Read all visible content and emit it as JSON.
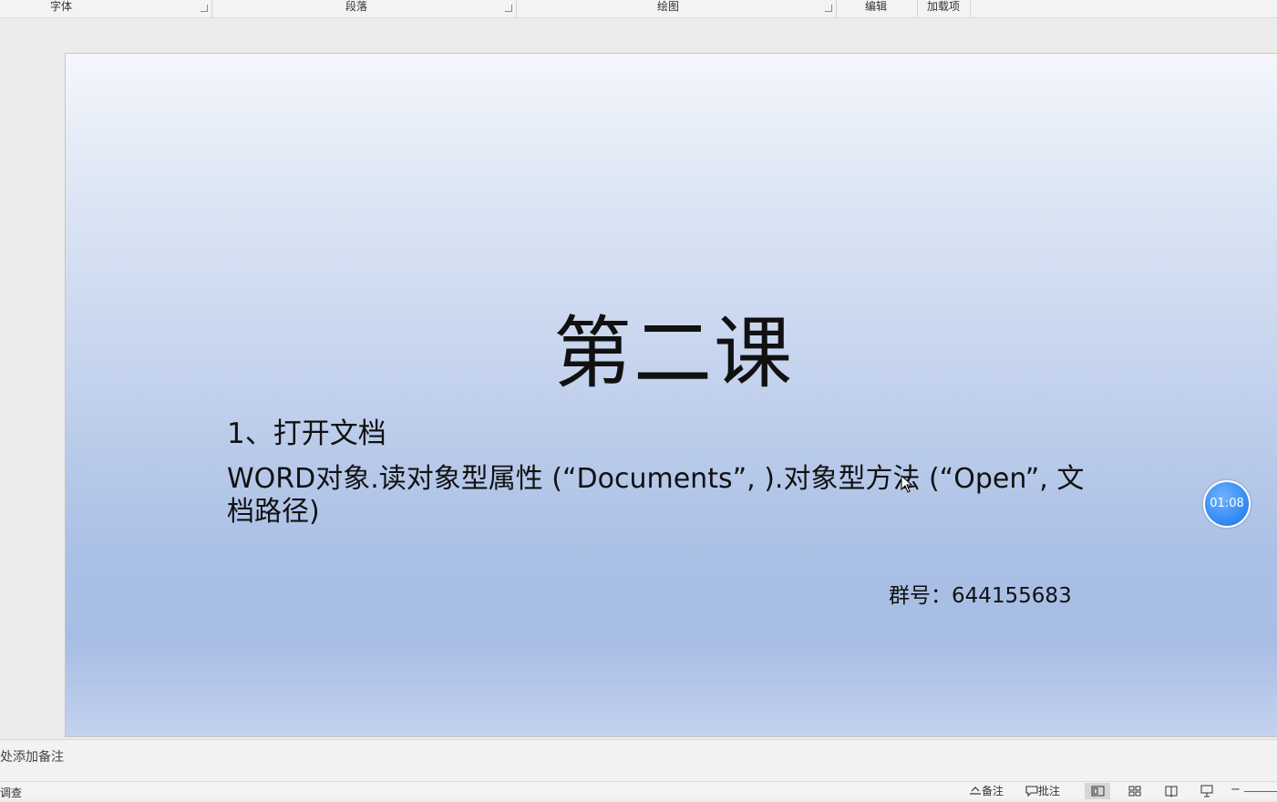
{
  "ribbon": {
    "groups": [
      "字体",
      "段落",
      "绘图",
      "编辑",
      "加载项"
    ]
  },
  "slide": {
    "title": "第二课",
    "bullet1": "1、打开文档",
    "body": "WORD对象.读对象型属性 (“Documents”, ).对象型方法 (“Open”, 文档路径)",
    "group_number": "群号：644155683"
  },
  "timer": {
    "value": "01:08"
  },
  "notes": {
    "placeholder": "处添加备注"
  },
  "status": {
    "left": "调查",
    "notes_btn": "备注",
    "comments_btn": "批注"
  },
  "colors": {
    "timer_blue": "#2f86f0",
    "slide_top": "#f5f7fc",
    "slide_mid": "#a9bfe5"
  },
  "icons": [
    "notes-icon",
    "comment-icon",
    "normal-view-icon",
    "slide-sorter-icon",
    "reading-view-icon",
    "slideshow-icon",
    "mouse-cursor-icon"
  ]
}
